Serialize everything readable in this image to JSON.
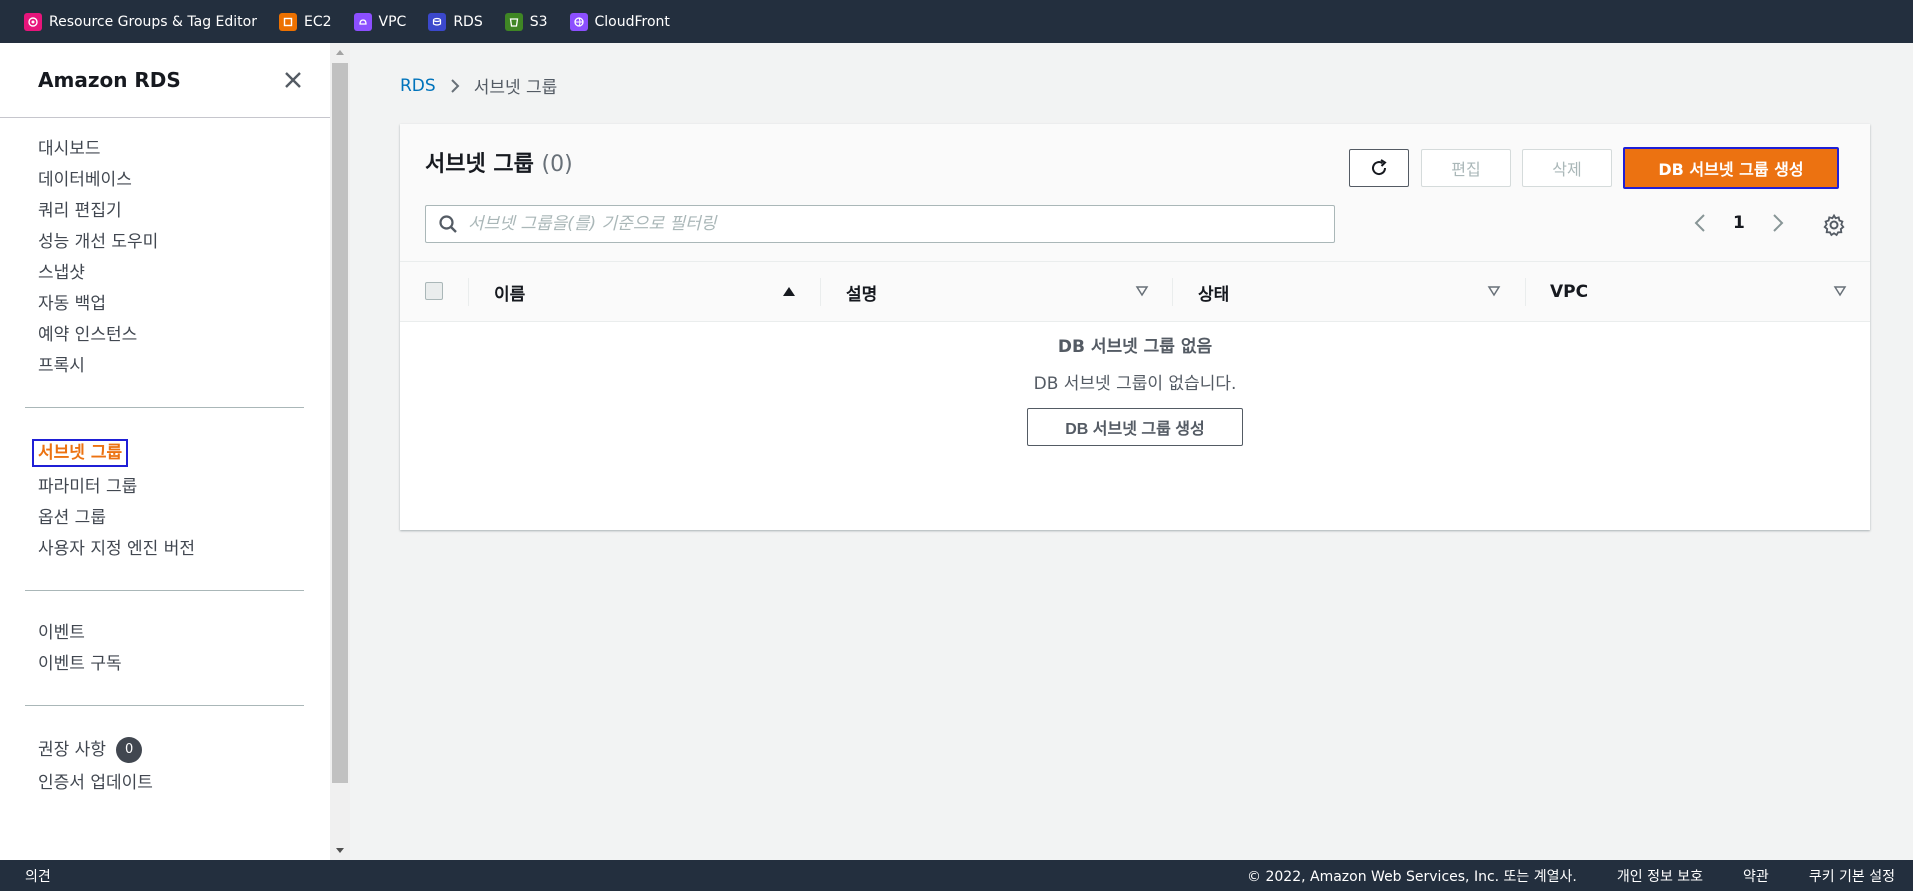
{
  "topbar": {
    "favorites": [
      {
        "label": "Resource Groups & Tag Editor",
        "color": "#e7157b",
        "icon": "resource-groups-icon"
      },
      {
        "label": "EC2",
        "color": "#ed7100",
        "icon": "ec2-icon"
      },
      {
        "label": "VPC",
        "color": "#8c4fff",
        "icon": "vpc-icon"
      },
      {
        "label": "RDS",
        "color": "#3b48cc",
        "icon": "rds-icon"
      },
      {
        "label": "S3",
        "color": "#3f8624",
        "icon": "s3-icon"
      },
      {
        "label": "CloudFront",
        "color": "#8c4fff",
        "icon": "cloudfront-icon"
      }
    ]
  },
  "sidebar": {
    "title": "Amazon RDS",
    "sections": [
      [
        "대시보드",
        "데이터베이스",
        "쿼리 편집기",
        "성능 개선 도우미",
        "스냅샷",
        "자동 백업",
        "예약 인스턴스",
        "프록시"
      ],
      [
        "서브넷 그룹",
        "파라미터 그룹",
        "옵션 그룹",
        "사용자 지정 엔진 버전"
      ],
      [
        "이벤트",
        "이벤트 구독"
      ],
      [
        "권장 사항",
        "인증서 업데이트"
      ]
    ],
    "active_item": "서브넷 그룹",
    "recommendations_badge": "0"
  },
  "breadcrumb": {
    "root": "RDS",
    "current": "서브넷 그룹"
  },
  "panel": {
    "title": "서브넷 그룹",
    "count": "(0)",
    "edit_label": "편집",
    "delete_label": "삭제",
    "create_label": "DB 서브넷 그룹 생성",
    "search_placeholder": "서브넷 그룹을(를) 기준으로 필터링",
    "page": "1",
    "columns": [
      "이름",
      "설명",
      "상태",
      "VPC"
    ],
    "empty_title": "DB 서브넷 그룹 없음",
    "empty_desc": "DB 서브넷 그룹이 없습니다.",
    "empty_button": "DB 서브넷 그룹 생성"
  },
  "footer": {
    "feedback": "의견",
    "copyright": "© 2022, Amazon Web Services, Inc. 또는 계열사.",
    "privacy": "개인 정보 보호",
    "terms": "약관",
    "cookies": "쿠키 기본 설정"
  },
  "colors": {
    "accent": "#ec7211",
    "link": "#0073bb",
    "nav_bg": "#232f3e"
  }
}
